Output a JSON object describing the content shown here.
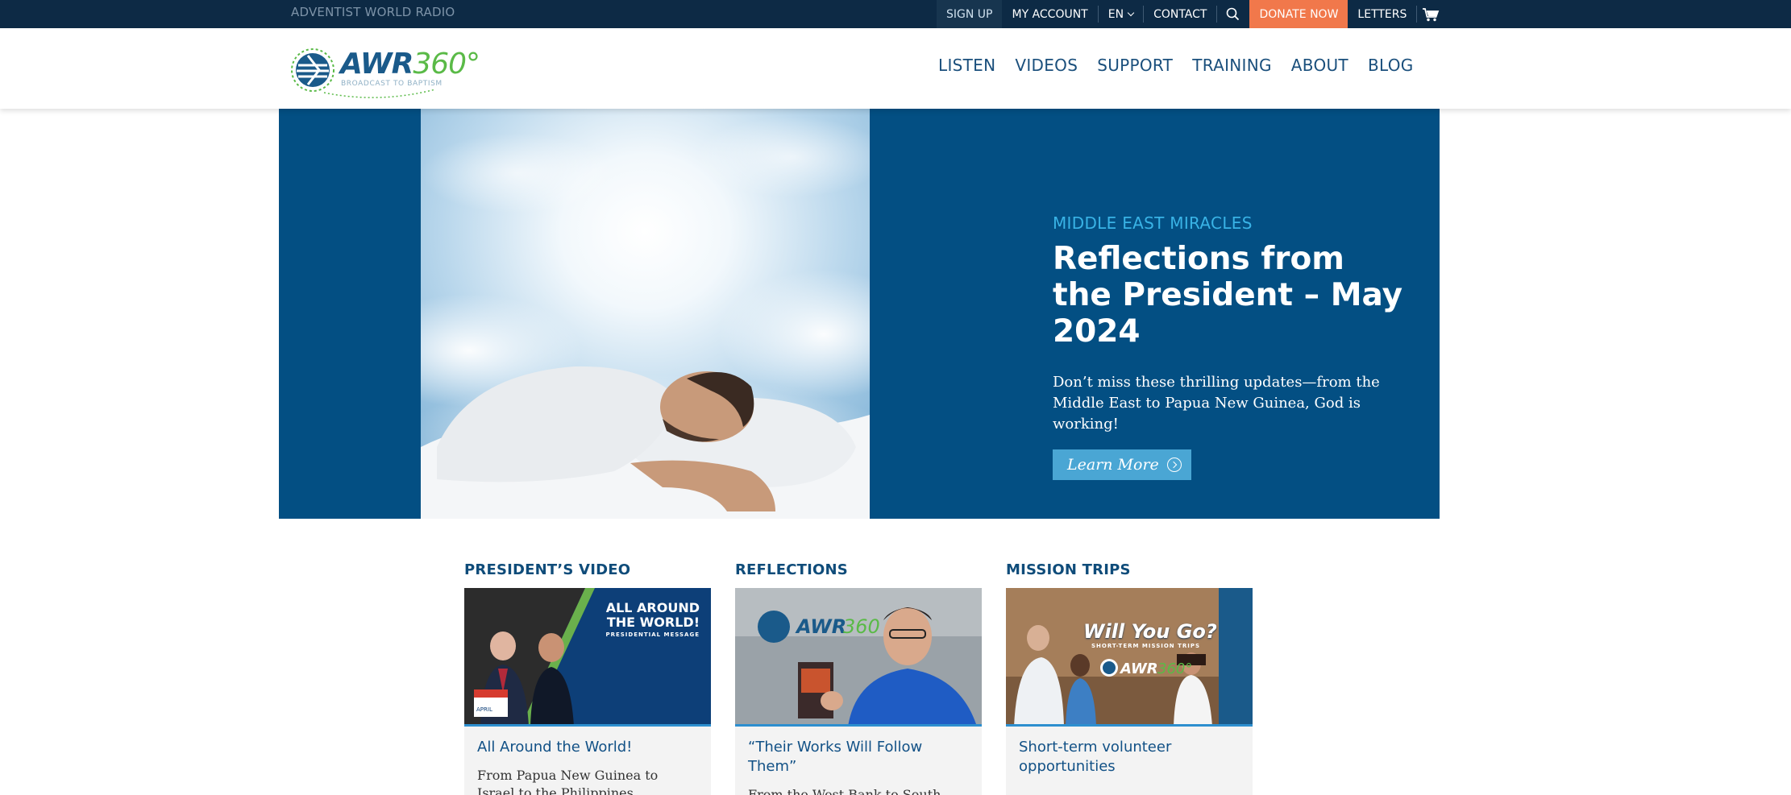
{
  "topbar": {
    "brand": "ADVENTIST WORLD RADIO",
    "links": {
      "signup": "SIGN UP",
      "account": "MY ACCOUNT",
      "lang": "EN",
      "contact": "CONTACT",
      "donate": "DONATE NOW",
      "letters": "LETTERS"
    },
    "icons": {
      "search": "search-icon",
      "cart": "cart-icon"
    }
  },
  "header": {
    "logo_text": "AWR",
    "logo_text_accent": "360°",
    "logo_tagline": "BROADCAST TO BAPTISM",
    "nav": [
      "LISTEN",
      "VIDEOS",
      "SUPPORT",
      "TRAINING",
      "ABOUT",
      "BLOG"
    ]
  },
  "hero": {
    "kicker": "MIDDLE EAST MIRACLES",
    "title": "Reflections from the President – May 2024",
    "description": "Don’t miss these thrilling updates—from the Middle East to Papua New Guinea, God is working!",
    "button": "Learn More"
  },
  "cards": [
    {
      "heading": "PRESIDENT’S VIDEO",
      "image_text": [
        "ALL AROUND",
        "THE WORLD!",
        "PRESIDENTIAL MESSAGE"
      ],
      "image_badge": "APRIL",
      "title": "All Around the World!",
      "desc": "From Papua New Guinea to Israel to the Philippines"
    },
    {
      "heading": "REFLECTIONS",
      "title": "“Their Works Will Follow Them”",
      "desc": "From the West Bank to South America to the Philippines"
    },
    {
      "heading": "MISSION TRIPS",
      "image_text": [
        "Will You Go?",
        "SHORT-TERM MISSION TRIPS"
      ],
      "title": "Short-term volunteer opportunities",
      "desc": ""
    }
  ],
  "colors": {
    "topbar": "#0d2a45",
    "hero": "#034f83",
    "donate": "#f1784b",
    "accent": "#39b3e6",
    "button": "#4aa6d4"
  }
}
